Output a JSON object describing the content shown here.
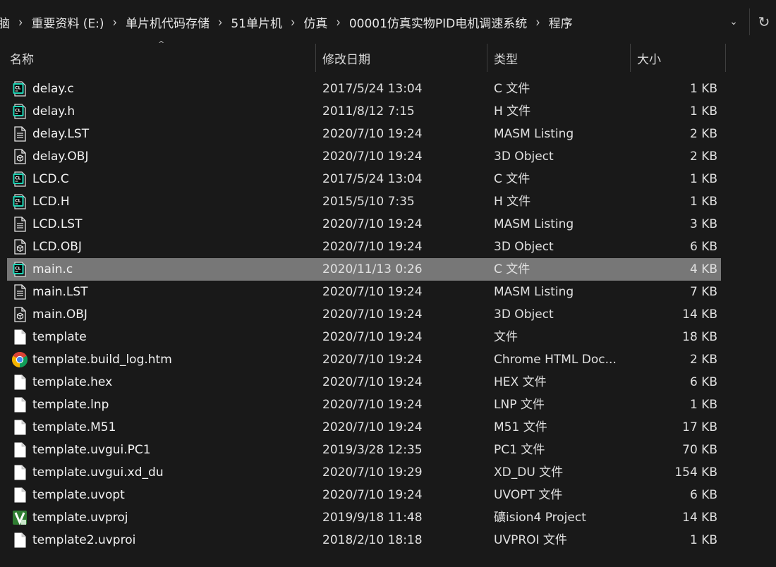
{
  "breadcrumbs": [
    "脑",
    "重要资料 (E:)",
    "单片机代码存储",
    "51单片机",
    "仿真",
    "00001仿真实物PID电机调速系统",
    "程序"
  ],
  "address": {
    "dropdown_glyph": "⌄",
    "refresh_glyph": "↻"
  },
  "columns": {
    "name": "名称",
    "date": "修改日期",
    "type": "类型",
    "size": "大小",
    "sort_glyph": "^"
  },
  "files": [
    {
      "name": "delay.c",
      "date": "2017/5/24 13:04",
      "type": "C 文件",
      "size": "1 KB",
      "icon": "clion-file-icon"
    },
    {
      "name": "delay.h",
      "date": "2011/8/12 7:15",
      "type": "H 文件",
      "size": "1 KB",
      "icon": "clion-file-icon"
    },
    {
      "name": "delay.LST",
      "date": "2020/7/10 19:24",
      "type": "MASM Listing",
      "size": "2 KB",
      "icon": "text-file-icon"
    },
    {
      "name": "delay.OBJ",
      "date": "2020/7/10 19:24",
      "type": "3D Object",
      "size": "2 KB",
      "icon": "3d-object-icon"
    },
    {
      "name": "LCD.C",
      "date": "2017/5/24 13:04",
      "type": "C 文件",
      "size": "1 KB",
      "icon": "clion-file-icon"
    },
    {
      "name": "LCD.H",
      "date": "2015/5/10 7:35",
      "type": "H 文件",
      "size": "1 KB",
      "icon": "clion-file-icon"
    },
    {
      "name": "LCD.LST",
      "date": "2020/7/10 19:24",
      "type": "MASM Listing",
      "size": "3 KB",
      "icon": "text-file-icon"
    },
    {
      "name": "LCD.OBJ",
      "date": "2020/7/10 19:24",
      "type": "3D Object",
      "size": "6 KB",
      "icon": "3d-object-icon"
    },
    {
      "name": "main.c",
      "date": "2020/11/13 0:26",
      "type": "C 文件",
      "size": "4 KB",
      "icon": "clion-file-icon",
      "selected": true
    },
    {
      "name": "main.LST",
      "date": "2020/7/10 19:24",
      "type": "MASM Listing",
      "size": "7 KB",
      "icon": "text-file-icon"
    },
    {
      "name": "main.OBJ",
      "date": "2020/7/10 19:24",
      "type": "3D Object",
      "size": "14 KB",
      "icon": "3d-object-icon"
    },
    {
      "name": "template",
      "date": "2020/7/10 19:24",
      "type": "文件",
      "size": "18 KB",
      "icon": "blank-file-icon"
    },
    {
      "name": "template.build_log.htm",
      "date": "2020/7/10 19:24",
      "type": "Chrome HTML Doc...",
      "size": "2 KB",
      "icon": "chrome-icon"
    },
    {
      "name": "template.hex",
      "date": "2020/7/10 19:24",
      "type": "HEX 文件",
      "size": "6 KB",
      "icon": "blank-file-icon"
    },
    {
      "name": "template.lnp",
      "date": "2020/7/10 19:24",
      "type": "LNP 文件",
      "size": "1 KB",
      "icon": "blank-file-icon"
    },
    {
      "name": "template.M51",
      "date": "2020/7/10 19:24",
      "type": "M51 文件",
      "size": "17 KB",
      "icon": "blank-file-icon"
    },
    {
      "name": "template.uvgui.PC1",
      "date": "2019/3/28 12:35",
      "type": "PC1 文件",
      "size": "70 KB",
      "icon": "blank-file-icon"
    },
    {
      "name": "template.uvgui.xd_du",
      "date": "2020/7/10 19:29",
      "type": "XD_DU 文件",
      "size": "154 KB",
      "icon": "blank-file-icon"
    },
    {
      "name": "template.uvopt",
      "date": "2020/7/10 19:24",
      "type": "UVOPT 文件",
      "size": "6 KB",
      "icon": "blank-file-icon"
    },
    {
      "name": "template.uvproj",
      "date": "2019/9/18 11:48",
      "type": "礦ision4 Project",
      "size": "14 KB",
      "icon": "keil-uvision-icon"
    },
    {
      "name": "template2.uvproi",
      "date": "2018/2/10 18:18",
      "type": "UVPROI 文件",
      "size": "1 KB",
      "icon": "blank-file-icon"
    }
  ]
}
